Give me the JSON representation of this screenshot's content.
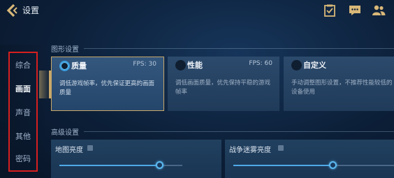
{
  "header": {
    "title": "设置",
    "icons": [
      "back-icon",
      "task-icon",
      "chat-icon",
      "friends-icon"
    ]
  },
  "sidebar": {
    "items": [
      {
        "label": "综合"
      },
      {
        "label": "画面"
      },
      {
        "label": "声音"
      },
      {
        "label": "其他"
      },
      {
        "label": "密码"
      }
    ],
    "active": "画面"
  },
  "graphics": {
    "section_title": "图形设置",
    "options": [
      {
        "name": "质量",
        "fps": "FPS: 30",
        "desc": "调低游戏帧率，优先保证更高的画面质量",
        "selected": true
      },
      {
        "name": "性能",
        "fps": "FPS: 60",
        "desc": "调低画面质量，优先保持平稳的游戏帧率",
        "selected": false
      },
      {
        "name": "自定义",
        "fps": "",
        "desc": "手动调整图形设置，不推荐性能较低的设备使用",
        "selected": false
      }
    ]
  },
  "advanced": {
    "section_title": "高级设置",
    "sliders": [
      {
        "label": "地图亮度",
        "value_fraction": 0.82
      },
      {
        "label": "战争迷雾亮度",
        "value_fraction": 0.62
      }
    ]
  },
  "colors": {
    "accent_gold": "#c9a86a",
    "slider_blue": "#4fa9e6",
    "highlight_red": "#d61f1f"
  }
}
